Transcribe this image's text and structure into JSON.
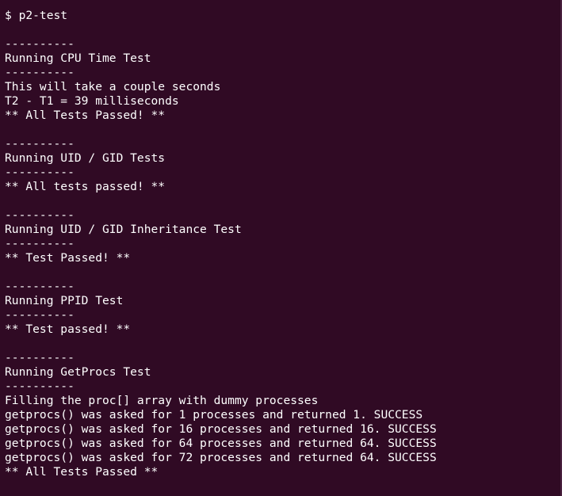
{
  "terminal": {
    "background": "#300a24",
    "foreground": "#ffffff",
    "lines": [
      "$ p2-test",
      "",
      "----------",
      "Running CPU Time Test",
      "----------",
      "This will take a couple seconds",
      "T2 - T1 = 39 milliseconds",
      "** All Tests Passed! **",
      "",
      "----------",
      "Running UID / GID Tests",
      "----------",
      "** All tests passed! **",
      "",
      "----------",
      "Running UID / GID Inheritance Test",
      "----------",
      "** Test Passed! **",
      "",
      "----------",
      "Running PPID Test",
      "----------",
      "** Test passed! **",
      "",
      "----------",
      "Running GetProcs Test",
      "----------",
      "Filling the proc[] array with dummy processes",
      "getprocs() was asked for 1 processes and returned 1. SUCCESS",
      "getprocs() was asked for 16 processes and returned 16. SUCCESS",
      "getprocs() was asked for 64 processes and returned 64. SUCCESS",
      "getprocs() was asked for 72 processes and returned 64. SUCCESS",
      "** All Tests Passed **"
    ]
  }
}
